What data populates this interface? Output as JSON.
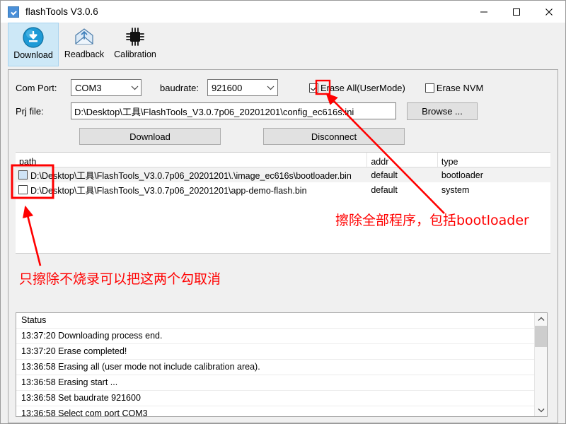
{
  "window": {
    "title": "flashTools V3.0.6",
    "icon": "app-icon",
    "controls": {
      "minimize": "minimize-icon",
      "maximize": "maximize-icon",
      "close": "close-icon"
    }
  },
  "toolbar": {
    "items": [
      {
        "label": "Download",
        "icon": "download-circle-icon",
        "active": true
      },
      {
        "label": "Readback",
        "icon": "envelope-upload-icon",
        "active": false
      },
      {
        "label": "Calibration",
        "icon": "chip-icon",
        "active": false
      }
    ]
  },
  "form": {
    "com_port_label": "Com Port:",
    "com_port_value": "COM3",
    "baudrate_label": "baudrate:",
    "baudrate_value": "921600",
    "erase_all_label": "Erase All(UserMode)",
    "erase_all_checked": true,
    "erase_nvm_label": "Erase NVM",
    "erase_nvm_checked": false,
    "prj_file_label": "Prj file:",
    "prj_file_value": "D:\\Desktop\\工具\\FlashTools_V3.0.7p06_20201201\\config_ec616s.ini",
    "browse_label": "Browse ...",
    "download_label": "Download",
    "disconnect_label": "Disconnect"
  },
  "file_table": {
    "columns": [
      "path",
      "addr",
      "type"
    ],
    "rows": [
      {
        "checked": false,
        "tinted": true,
        "path": "D:\\Desktop\\工具\\FlashTools_V3.0.7p06_20201201\\.\\image_ec616s\\bootloader.bin",
        "addr": "default",
        "type": "bootloader"
      },
      {
        "checked": false,
        "tinted": false,
        "path": "D:\\Desktop\\工具\\FlashTools_V3.0.7p06_20201201\\app-demo-flash.bin",
        "addr": "default",
        "type": "system"
      }
    ]
  },
  "status": {
    "header": "Status",
    "lines": [
      "13:37:20 Downloading process end.",
      "13:37:20 Erase completed!",
      "13:36:58 Erasing all (user mode not include calibration area).",
      "13:36:58 Erasing start ...",
      "13:36:58 Set baudrate 921600",
      "13:36:58 Select com port COM3"
    ],
    "scroll_up_icon": "chevron-up-icon",
    "scroll_down_icon": "chevron-down-icon"
  },
  "annotations": {
    "color": "#ff0000",
    "note_erase_all": "擦除全部程序，包括bootloader",
    "note_uncheck_rows": "只擦除不烧录可以把这两个勾取消"
  }
}
